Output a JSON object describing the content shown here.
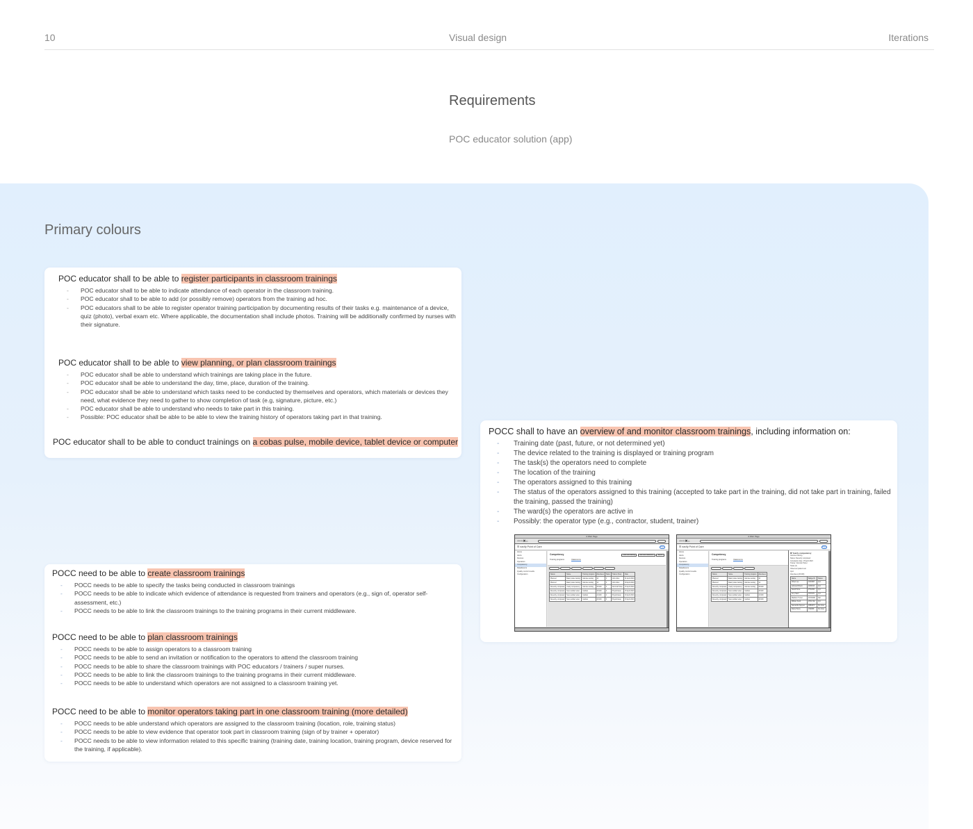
{
  "header": {
    "page_number": "10",
    "section": "Visual design",
    "chapter": "Iterations"
  },
  "requirements": {
    "title": "Requirements",
    "subtitle": "POC educator solution (app)"
  },
  "panel": {
    "title": "Primary colours",
    "highlight_color": "#f8c4b0",
    "background_color": "#e1effd"
  },
  "card1": {
    "sections": [
      {
        "prefix": "POC educator shall to be able to ",
        "highlight": "register participants in classroom trainings",
        "items": [
          "POC educator shall to be able to indicate attendance of each operator in the classroom training.",
          "POC educator shall to be able to add (or possibly remove) operators from the training ad hoc.",
          "POC educators shall to be able to register operator training participation by  documenting results of their tasks e.g. maintenance of a device, quiz (photo), verbal exam etc. Where applicable, the documentation shall include photos. Training will be additionally confirmed by nurses with their signature."
        ]
      },
      {
        "prefix": "POC educator shall to be able to ",
        "highlight": "view planning, or plan classroom trainings",
        "items": [
          "POC educator shall be able to understand which trainings are taking place in the future.",
          "POC educator shall be able to understand the day, time, place, duration of the training.",
          "POC educator shall be able to understand which tasks need to be conducted by themselves and operators, which materials or devices they need, what evidence they need to gather to show completion of task (e.g, signature, picture, etc.)",
          "POC educator shall be able to understand who needs to take part in this training.",
          "Possible: POC educator shall be able to be able to view the training history of operators taking part in that training."
        ]
      },
      {
        "prefix": "POC educator shall to be able to conduct trainings on ",
        "highlight": "a cobas pulse, mobile device, tablet device or computer",
        "items": []
      }
    ]
  },
  "card2": {
    "sections": [
      {
        "prefix": "POCC need to be able to ",
        "highlight": "create classroom trainings",
        "items": [
          "POCC needs to be able to specify the tasks being conducted in classroom trainings",
          "POCC needs to be able to indicate which evidence of attendance is requested from trainers and operators (e.g., sign of, operator self-assessment, etc.)",
          "POCC needs to be able to link the classroom trainings to the training programs in their current middleware."
        ]
      },
      {
        "prefix": "POCC need to be able to ",
        "highlight": "plan classroom trainings",
        "items": [
          "POCC needs to be able to assign operators to a classroom training",
          "POCC needs to be able to send an invitation or notification  to the operators to attend the classroom training",
          "POCC needs to be able to share the classroom trainings with POC educators / trainers / super nurses.",
          "POCC needs to be able to link the classroom trainings to the training programs in their current middleware.",
          "POCC needs to be able to understand which operators are not assigned to a classroom training yet."
        ]
      },
      {
        "prefix": "POCC need to be able to ",
        "highlight": "monitor operators taking part in one classroom training (more detailed)",
        "items": [
          "POCC needs to be able understand which operators are assigned to the classroom training (location, role, training status)",
          "POCC needs to be able to view evidence that operator took part in classroom training (sign of by trainer + operator)",
          "POCC needs to be able to view information related to this specific training (training date, training location, training program, device reserved for the training, if applicable)."
        ]
      }
    ]
  },
  "card3": {
    "prefix": "POCC shall to have an ",
    "highlight": "overview of and monitor classroom trainings",
    "suffix": ", including information on:",
    "items": [
      "Training date (past, future, or not determined yet)",
      "The device related to the training is displayed or training program",
      "The task(s) the operators need to complete",
      "The location of the training",
      "The operators assigned to this training",
      "The status of the operators assigned to this training (accepted to take part in the training, did not take part in training, failed the training, passed the training)",
      "The ward(s) the operators are active in",
      "Possibly: the operator type (e.g., contractor, student, trainer)"
    ]
  },
  "wireframe": {
    "window_title": "A Web Page",
    "app_name": "navify Point of Care",
    "help_label": "Help",
    "page_title": "Competency",
    "tabs": [
      "Training programs",
      "Classrooms"
    ],
    "buttons": [
      "Add new training",
      "Add new classroom",
      "Export"
    ],
    "sidebar": [
      "Home",
      "Alerts",
      "Devices",
      "Operators",
      "Competency",
      "Data/Events",
      "Quality control results",
      "Configuration"
    ],
    "columns": [
      "Status",
      "Name",
      "Training program",
      "Attendees",
      "Tasks",
      "Trainer (Due)",
      "Date"
    ],
    "rows": [
      [
        "Planned",
        "Basic pulse training",
        "Glucose testing",
        "10",
        "3",
        "John Allen",
        "01 April 2023"
      ],
      [
        "Planned",
        "Basic pulse training",
        "Glucose testing",
        "12",
        "3",
        "John Allen",
        "03 April 2023"
      ],
      [
        "Recently completed",
        "Yearly competency",
        "Glucose testing",
        "20/100",
        "3",
        "Dominik Huber",
        "15 April 2023"
      ],
      [
        "Recently completed",
        "New cardiac tester",
        "Cardiac",
        "20/100",
        "3",
        "Pinyah Euan",
        "15 April 2023"
      ],
      [
        "Recently completed",
        "New cardiac tester",
        "Cardiac",
        "21/100",
        "4",
        "Pinyah Euan",
        "16 April 2023"
      ],
      [
        "Recently completed",
        "New cardiac tester",
        "Cardiac",
        "20/100",
        "3",
        "Pinyah Euan",
        "15 April 2023"
      ]
    ],
    "drawer": {
      "title": "Yearly competency",
      "subtitle": "Glucose training",
      "close_label": "Full view",
      "lines": [
        "Status: Recently completed",
        "Completion date: 15 April 2023",
        "Trainer: Dominik Huber",
        "Tasks (3)",
        "Observed patient test",
        "Quiz",
        "Attendees (20/100)"
      ],
      "columns": [
        "Name",
        "Badge ID",
        "Status"
      ],
      "rows": [
        [
          "Oliver Lee",
          "23X4567",
          "Q.C."
        ],
        [
          "Adriana Ribeiro",
          "23Z4913",
          "Q.C."
        ],
        [
          "Sarah Petra",
          "2TS2633",
          "Q.C."
        ],
        [
          "Amy Nasir",
          "2ST6371",
          "Q.C."
        ],
        [
          "Madison Turner",
          "2S7DA89",
          "Fail"
        ],
        [
          "William Scott",
          "2TDL7A0",
          "Q.C."
        ],
        [
          "Samantha Nguyen",
          "2RB4073",
          "No show"
        ],
        [
          "Daniel Nova",
          "2S9D89",
          "No show"
        ]
      ]
    }
  }
}
